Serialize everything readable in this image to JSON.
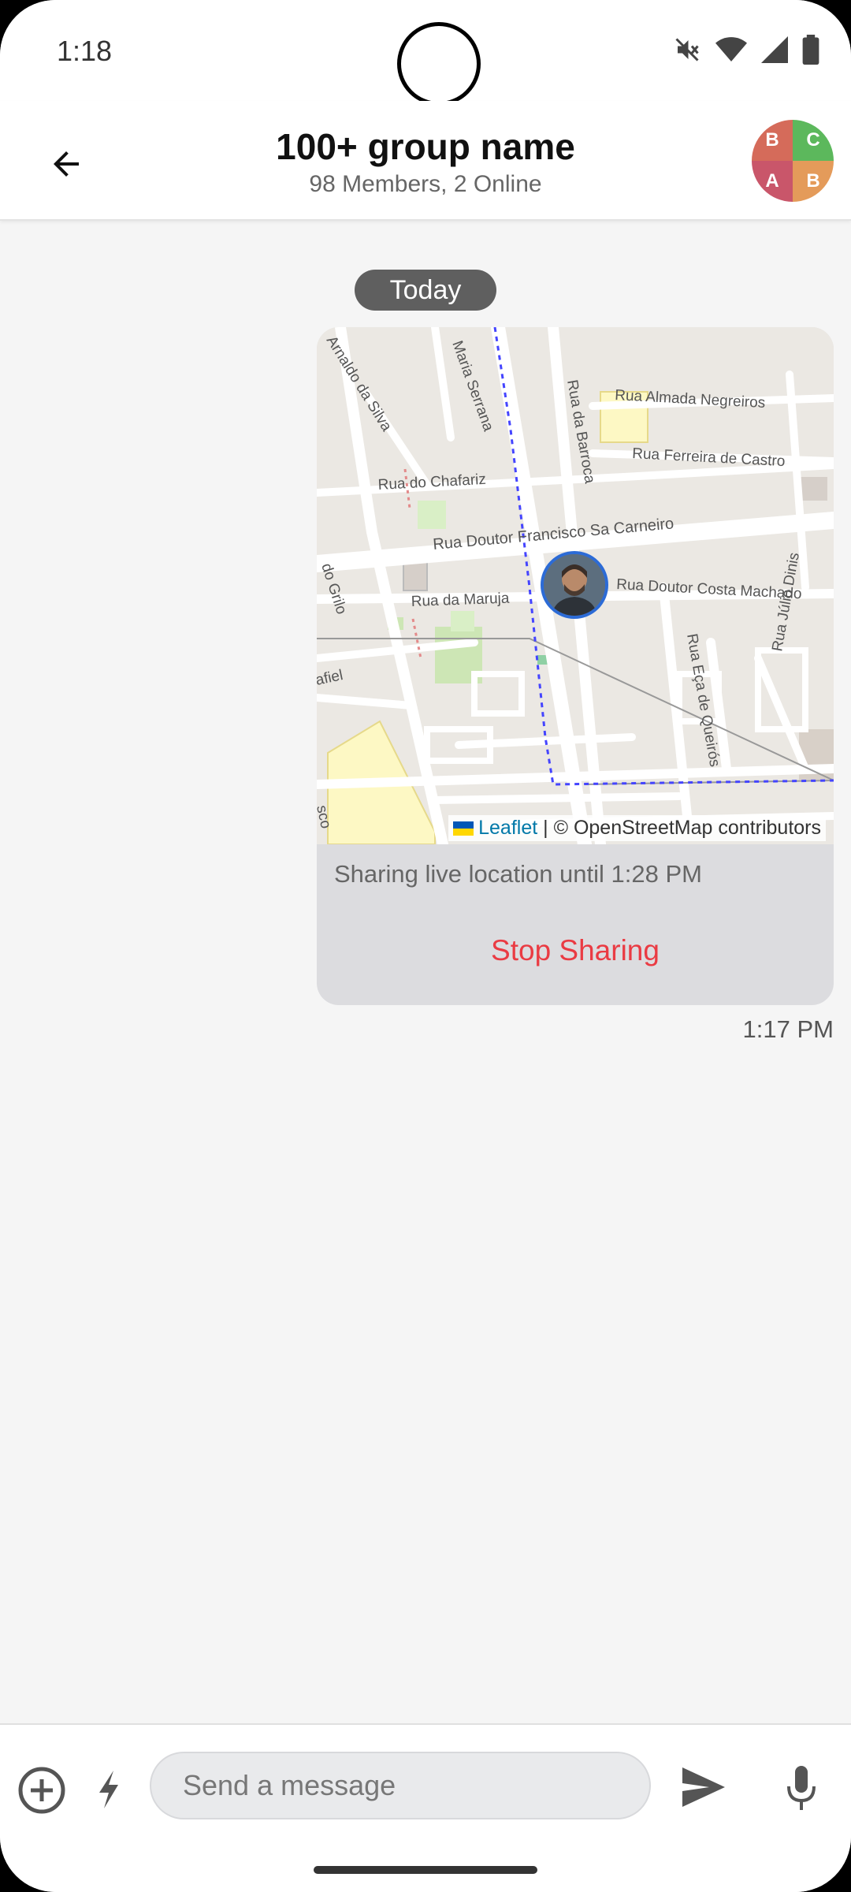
{
  "status_bar": {
    "time": "1:18",
    "icons": [
      "mute-icon",
      "wifi-icon",
      "signal-icon",
      "battery-icon"
    ]
  },
  "header": {
    "title": "100+ group name",
    "subtitle": "98 Members, 2 Online",
    "avatar_letters": [
      "B",
      "C",
      "A",
      "B"
    ],
    "avatar_colors": [
      "#d56b5a",
      "#5cb85c",
      "#c9566a",
      "#e49b5a"
    ]
  },
  "chat": {
    "date_label": "Today",
    "location_message": {
      "map": {
        "street_labels": [
          "Rua Almada Negreiros",
          "Rua Ferreira de Castro",
          "Rua do Chafariz",
          "Rua Doutor Francisco Sa Carneiro",
          "Rua da Maruja",
          "Rua Doutor Costa Machado",
          "Rua Eça de Queirós",
          "Rua Júlio Dinis",
          "Rua da Barroca",
          "Maria Serrana",
          "Arnaldo da Silva",
          "do Grilo",
          "afiel",
          "sco"
        ],
        "attribution_leaflet": "Leaflet",
        "attribution_rest": "| © OpenStreetMap contributors"
      },
      "sharing_text": "Sharing live location until 1:28 PM",
      "stop_label": "Stop Sharing",
      "time": "1:17 PM"
    }
  },
  "composer": {
    "placeholder": "Send a message"
  },
  "colors": {
    "accent_red": "#ea3b43",
    "bubble": "#dcdcdf",
    "marker_border": "#2c6bd6"
  }
}
